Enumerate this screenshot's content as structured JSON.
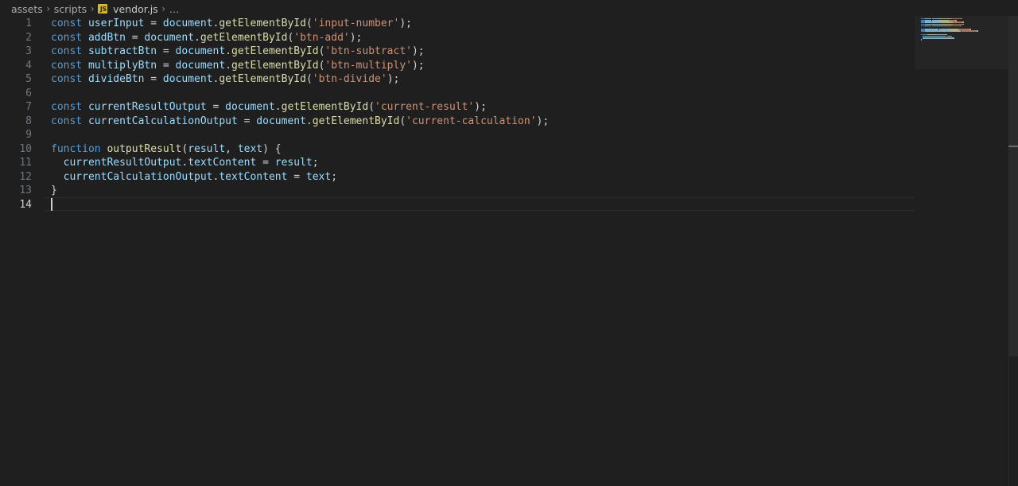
{
  "breadcrumb": {
    "items": [
      "assets",
      "scripts"
    ],
    "file": "vendor.js",
    "file_icon": "JS",
    "more": "…",
    "separator": "›"
  },
  "editor": {
    "active_line": 14,
    "lines": [
      {
        "n": "1",
        "tokens": [
          [
            "kw",
            "const "
          ],
          [
            "var",
            "userInput"
          ],
          [
            "punc",
            " = "
          ],
          [
            "var",
            "document"
          ],
          [
            "punc",
            "."
          ],
          [
            "fn",
            "getElementById"
          ],
          [
            "punc",
            "("
          ],
          [
            "str",
            "'input-number'"
          ],
          [
            "punc",
            ");"
          ]
        ]
      },
      {
        "n": "2",
        "tokens": [
          [
            "kw",
            "const "
          ],
          [
            "var",
            "addBtn"
          ],
          [
            "punc",
            " = "
          ],
          [
            "var",
            "document"
          ],
          [
            "punc",
            "."
          ],
          [
            "fn",
            "getElementById"
          ],
          [
            "punc",
            "("
          ],
          [
            "str",
            "'btn-add'"
          ],
          [
            "punc",
            ");"
          ]
        ]
      },
      {
        "n": "3",
        "tokens": [
          [
            "kw",
            "const "
          ],
          [
            "var",
            "subtractBtn"
          ],
          [
            "punc",
            " = "
          ],
          [
            "var",
            "document"
          ],
          [
            "punc",
            "."
          ],
          [
            "fn",
            "getElementById"
          ],
          [
            "punc",
            "("
          ],
          [
            "str",
            "'btn-subtract'"
          ],
          [
            "punc",
            ");"
          ]
        ]
      },
      {
        "n": "4",
        "tokens": [
          [
            "kw",
            "const "
          ],
          [
            "var",
            "multiplyBtn"
          ],
          [
            "punc",
            " = "
          ],
          [
            "var",
            "document"
          ],
          [
            "punc",
            "."
          ],
          [
            "fn",
            "getElementById"
          ],
          [
            "punc",
            "("
          ],
          [
            "str",
            "'btn-multiply'"
          ],
          [
            "punc",
            ");"
          ]
        ]
      },
      {
        "n": "5",
        "tokens": [
          [
            "kw",
            "const "
          ],
          [
            "var",
            "divideBtn"
          ],
          [
            "punc",
            " = "
          ],
          [
            "var",
            "document"
          ],
          [
            "punc",
            "."
          ],
          [
            "fn",
            "getElementById"
          ],
          [
            "punc",
            "("
          ],
          [
            "str",
            "'btn-divide'"
          ],
          [
            "punc",
            ");"
          ]
        ]
      },
      {
        "n": "6",
        "tokens": []
      },
      {
        "n": "7",
        "tokens": [
          [
            "kw",
            "const "
          ],
          [
            "var",
            "currentResultOutput"
          ],
          [
            "punc",
            " = "
          ],
          [
            "var",
            "document"
          ],
          [
            "punc",
            "."
          ],
          [
            "fn",
            "getElementById"
          ],
          [
            "punc",
            "("
          ],
          [
            "str",
            "'current-result'"
          ],
          [
            "punc",
            ");"
          ]
        ]
      },
      {
        "n": "8",
        "tokens": [
          [
            "kw",
            "const "
          ],
          [
            "var",
            "currentCalculationOutput"
          ],
          [
            "punc",
            " = "
          ],
          [
            "var",
            "document"
          ],
          [
            "punc",
            "."
          ],
          [
            "fn",
            "getElementById"
          ],
          [
            "punc",
            "("
          ],
          [
            "str",
            "'current-calculation'"
          ],
          [
            "punc",
            ");"
          ]
        ]
      },
      {
        "n": "9",
        "tokens": []
      },
      {
        "n": "10",
        "tokens": [
          [
            "kw",
            "function "
          ],
          [
            "fn",
            "outputResult"
          ],
          [
            "punc",
            "("
          ],
          [
            "var",
            "result"
          ],
          [
            "punc",
            ", "
          ],
          [
            "var",
            "text"
          ],
          [
            "punc",
            ") {"
          ]
        ]
      },
      {
        "n": "11",
        "tokens": [
          [
            "punc",
            "  "
          ],
          [
            "var",
            "currentResultOutput"
          ],
          [
            "punc",
            "."
          ],
          [
            "var",
            "textContent"
          ],
          [
            "punc",
            " = "
          ],
          [
            "var",
            "result"
          ],
          [
            "punc",
            ";"
          ]
        ]
      },
      {
        "n": "12",
        "tokens": [
          [
            "punc",
            "  "
          ],
          [
            "var",
            "currentCalculationOutput"
          ],
          [
            "punc",
            "."
          ],
          [
            "var",
            "textContent"
          ],
          [
            "punc",
            " = "
          ],
          [
            "var",
            "text"
          ],
          [
            "punc",
            ";"
          ]
        ]
      },
      {
        "n": "13",
        "tokens": [
          [
            "punc",
            "}"
          ]
        ]
      },
      {
        "n": "14",
        "tokens": []
      }
    ]
  },
  "colors": {
    "background": "#1f1f1f",
    "keyword": "#569cd6",
    "variable": "#9cdcfe",
    "function": "#dcdcaa",
    "string": "#ce9178",
    "punctuation": "#d4d4d4",
    "line_number": "#6e7681"
  }
}
